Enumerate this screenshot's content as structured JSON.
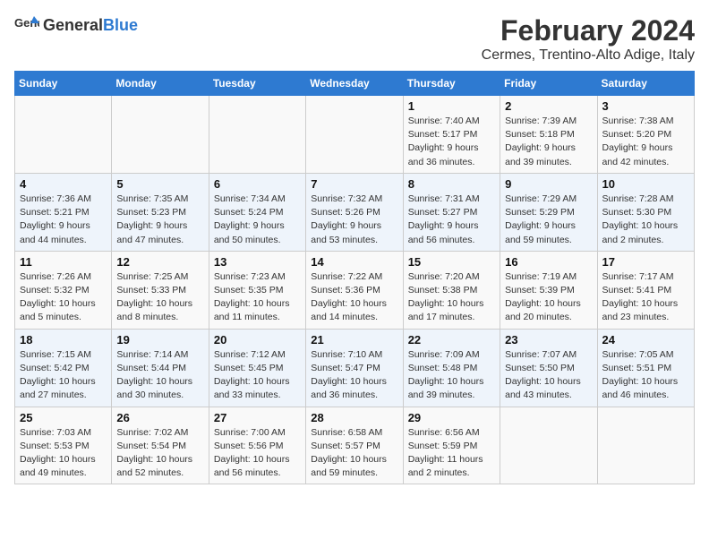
{
  "header": {
    "logo_general": "General",
    "logo_blue": "Blue",
    "main_title": "February 2024",
    "sub_title": "Cermes, Trentino-Alto Adige, Italy"
  },
  "columns": [
    "Sunday",
    "Monday",
    "Tuesday",
    "Wednesday",
    "Thursday",
    "Friday",
    "Saturday"
  ],
  "weeks": [
    [
      {
        "day": "",
        "info": ""
      },
      {
        "day": "",
        "info": ""
      },
      {
        "day": "",
        "info": ""
      },
      {
        "day": "",
        "info": ""
      },
      {
        "day": "1",
        "info": "Sunrise: 7:40 AM\nSunset: 5:17 PM\nDaylight: 9 hours and 36 minutes."
      },
      {
        "day": "2",
        "info": "Sunrise: 7:39 AM\nSunset: 5:18 PM\nDaylight: 9 hours and 39 minutes."
      },
      {
        "day": "3",
        "info": "Sunrise: 7:38 AM\nSunset: 5:20 PM\nDaylight: 9 hours and 42 minutes."
      }
    ],
    [
      {
        "day": "4",
        "info": "Sunrise: 7:36 AM\nSunset: 5:21 PM\nDaylight: 9 hours and 44 minutes."
      },
      {
        "day": "5",
        "info": "Sunrise: 7:35 AM\nSunset: 5:23 PM\nDaylight: 9 hours and 47 minutes."
      },
      {
        "day": "6",
        "info": "Sunrise: 7:34 AM\nSunset: 5:24 PM\nDaylight: 9 hours and 50 minutes."
      },
      {
        "day": "7",
        "info": "Sunrise: 7:32 AM\nSunset: 5:26 PM\nDaylight: 9 hours and 53 minutes."
      },
      {
        "day": "8",
        "info": "Sunrise: 7:31 AM\nSunset: 5:27 PM\nDaylight: 9 hours and 56 minutes."
      },
      {
        "day": "9",
        "info": "Sunrise: 7:29 AM\nSunset: 5:29 PM\nDaylight: 9 hours and 59 minutes."
      },
      {
        "day": "10",
        "info": "Sunrise: 7:28 AM\nSunset: 5:30 PM\nDaylight: 10 hours and 2 minutes."
      }
    ],
    [
      {
        "day": "11",
        "info": "Sunrise: 7:26 AM\nSunset: 5:32 PM\nDaylight: 10 hours and 5 minutes."
      },
      {
        "day": "12",
        "info": "Sunrise: 7:25 AM\nSunset: 5:33 PM\nDaylight: 10 hours and 8 minutes."
      },
      {
        "day": "13",
        "info": "Sunrise: 7:23 AM\nSunset: 5:35 PM\nDaylight: 10 hours and 11 minutes."
      },
      {
        "day": "14",
        "info": "Sunrise: 7:22 AM\nSunset: 5:36 PM\nDaylight: 10 hours and 14 minutes."
      },
      {
        "day": "15",
        "info": "Sunrise: 7:20 AM\nSunset: 5:38 PM\nDaylight: 10 hours and 17 minutes."
      },
      {
        "day": "16",
        "info": "Sunrise: 7:19 AM\nSunset: 5:39 PM\nDaylight: 10 hours and 20 minutes."
      },
      {
        "day": "17",
        "info": "Sunrise: 7:17 AM\nSunset: 5:41 PM\nDaylight: 10 hours and 23 minutes."
      }
    ],
    [
      {
        "day": "18",
        "info": "Sunrise: 7:15 AM\nSunset: 5:42 PM\nDaylight: 10 hours and 27 minutes."
      },
      {
        "day": "19",
        "info": "Sunrise: 7:14 AM\nSunset: 5:44 PM\nDaylight: 10 hours and 30 minutes."
      },
      {
        "day": "20",
        "info": "Sunrise: 7:12 AM\nSunset: 5:45 PM\nDaylight: 10 hours and 33 minutes."
      },
      {
        "day": "21",
        "info": "Sunrise: 7:10 AM\nSunset: 5:47 PM\nDaylight: 10 hours and 36 minutes."
      },
      {
        "day": "22",
        "info": "Sunrise: 7:09 AM\nSunset: 5:48 PM\nDaylight: 10 hours and 39 minutes."
      },
      {
        "day": "23",
        "info": "Sunrise: 7:07 AM\nSunset: 5:50 PM\nDaylight: 10 hours and 43 minutes."
      },
      {
        "day": "24",
        "info": "Sunrise: 7:05 AM\nSunset: 5:51 PM\nDaylight: 10 hours and 46 minutes."
      }
    ],
    [
      {
        "day": "25",
        "info": "Sunrise: 7:03 AM\nSunset: 5:53 PM\nDaylight: 10 hours and 49 minutes."
      },
      {
        "day": "26",
        "info": "Sunrise: 7:02 AM\nSunset: 5:54 PM\nDaylight: 10 hours and 52 minutes."
      },
      {
        "day": "27",
        "info": "Sunrise: 7:00 AM\nSunset: 5:56 PM\nDaylight: 10 hours and 56 minutes."
      },
      {
        "day": "28",
        "info": "Sunrise: 6:58 AM\nSunset: 5:57 PM\nDaylight: 10 hours and 59 minutes."
      },
      {
        "day": "29",
        "info": "Sunrise: 6:56 AM\nSunset: 5:59 PM\nDaylight: 11 hours and 2 minutes."
      },
      {
        "day": "",
        "info": ""
      },
      {
        "day": "",
        "info": ""
      }
    ]
  ]
}
